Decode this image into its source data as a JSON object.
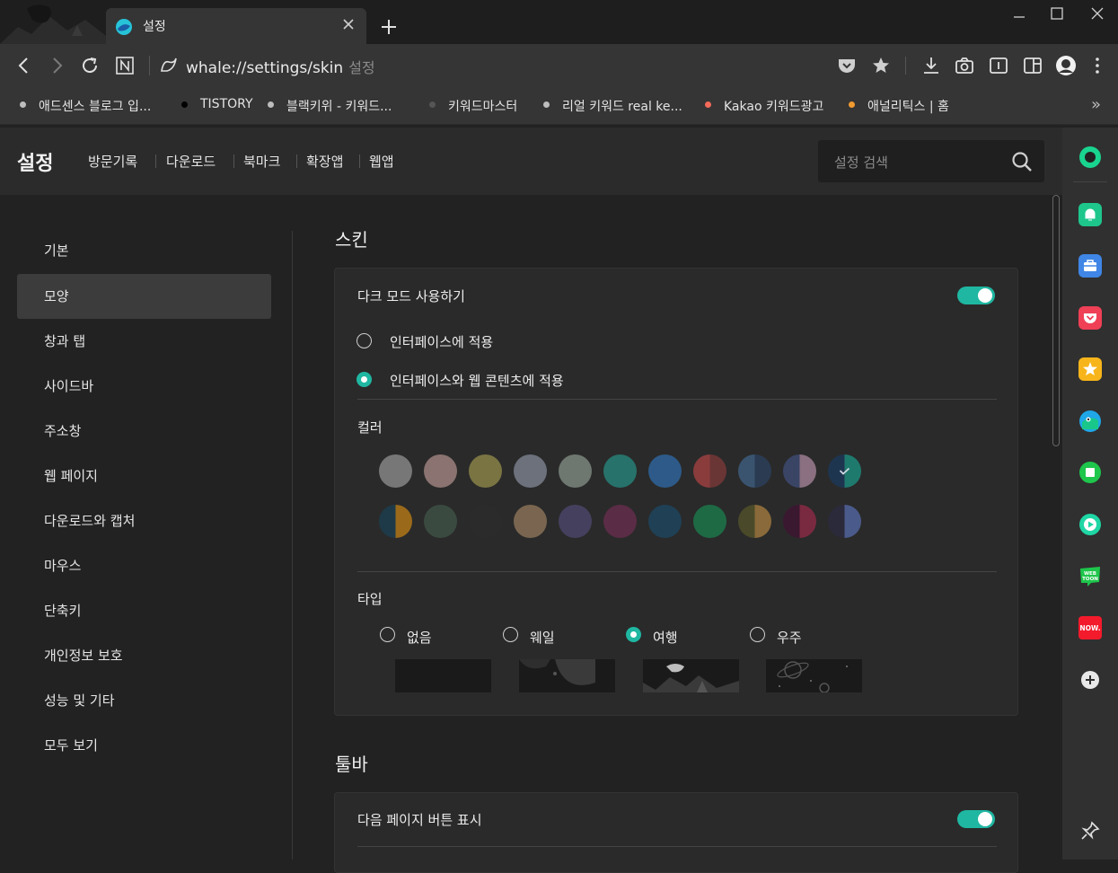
{
  "browser": {
    "tab_title": "설정",
    "url": "whale://settings/skin",
    "url_hint": "설정",
    "bookmarks": [
      {
        "label": "애드센스 블로그 입...",
        "dot": "#bdbdbd"
      },
      {
        "label": "TISTORY",
        "dot": "#000000"
      },
      {
        "label": "블랙키위 - 키워드...",
        "dot": "#bdbdbd"
      },
      {
        "label": "키워드마스터",
        "dot": "#555555"
      },
      {
        "label": "리얼 키워드 real ke...",
        "dot": "#bdbdbd"
      },
      {
        "label": "Kakao 키워드광고",
        "dot": "#f46a5a"
      },
      {
        "label": "애널리틱스 | 홈",
        "dot": "#f29b2f"
      }
    ],
    "more_label": "»"
  },
  "header": {
    "title": "설정",
    "nav": [
      "방문기록",
      "다운로드",
      "북마크",
      "확장앱",
      "웹앱"
    ],
    "search_placeholder": "설정 검색"
  },
  "menu": {
    "items": [
      "기본",
      "모양",
      "창과 탭",
      "사이드바",
      "주소창",
      "웹 페이지",
      "다운로드와 캡처",
      "마우스",
      "단축키",
      "개인정보 보호",
      "성능 및 기타",
      "모두 보기"
    ],
    "active_index": 1
  },
  "skin": {
    "section_title": "스킨",
    "dark_mode_label": "다크 모드 사용하기",
    "dark_mode_on": true,
    "apply_options": [
      "인터페이스에 적용",
      "인터페이스와 웹 콘텐츠에 적용"
    ],
    "apply_selected": 1,
    "color_label": "컬러",
    "colors_row1": [
      [
        "#777777",
        "#777777"
      ],
      [
        "#8a7370",
        "#8a7370"
      ],
      [
        "#7a7443",
        "#7a7443"
      ],
      [
        "#6c717c",
        "#6c717c"
      ],
      [
        "#6e7770",
        "#6e7770"
      ],
      [
        "#27726b",
        "#27726b"
      ],
      [
        "#2d5a88",
        "#2d5a88"
      ],
      [
        "#8a3c3c",
        "#6a3535"
      ],
      [
        "#3a5470",
        "#2a3b52"
      ],
      [
        "#3a4566",
        "#8a7080"
      ],
      [
        "#1e3550",
        "#1f7a6e"
      ]
    ],
    "colors_row2": [
      [
        "#1e3a48",
        "#9a6a1a"
      ],
      [
        "#3a4a40",
        "#3a4a40"
      ],
      [
        "#2b2b2b",
        "#2b2b2b"
      ],
      [
        "#7a6650",
        "#7a6650"
      ],
      [
        "#45405e",
        "#45405e"
      ],
      [
        "#5a2c45",
        "#5a2c45"
      ],
      [
        "#1f4055",
        "#1f4055"
      ],
      [
        "#1e6a45",
        "#1e6a45"
      ],
      [
        "#4a4a2a",
        "#8a6a3a"
      ],
      [
        "#3a1830",
        "#7a2a40"
      ],
      [
        "#2a2a3a",
        "#4a5a8a"
      ]
    ],
    "color_selected_index": 10,
    "type_label": "타입",
    "types": [
      "없음",
      "웨일",
      "여행",
      "우주"
    ],
    "type_selected": 2
  },
  "toolbar": {
    "section_title": "툴바",
    "next_page_label": "다음 페이지 버튼 표시",
    "next_page_on": true
  },
  "sidebar_icons": [
    "whale-space-icon",
    "notification-icon",
    "toolbox-icon",
    "pocket-icon",
    "favorites-icon",
    "papago-icon",
    "green-square-icon",
    "player-icon",
    "webtoon-icon",
    "now-icon",
    "add-icon",
    "pin-icon"
  ]
}
